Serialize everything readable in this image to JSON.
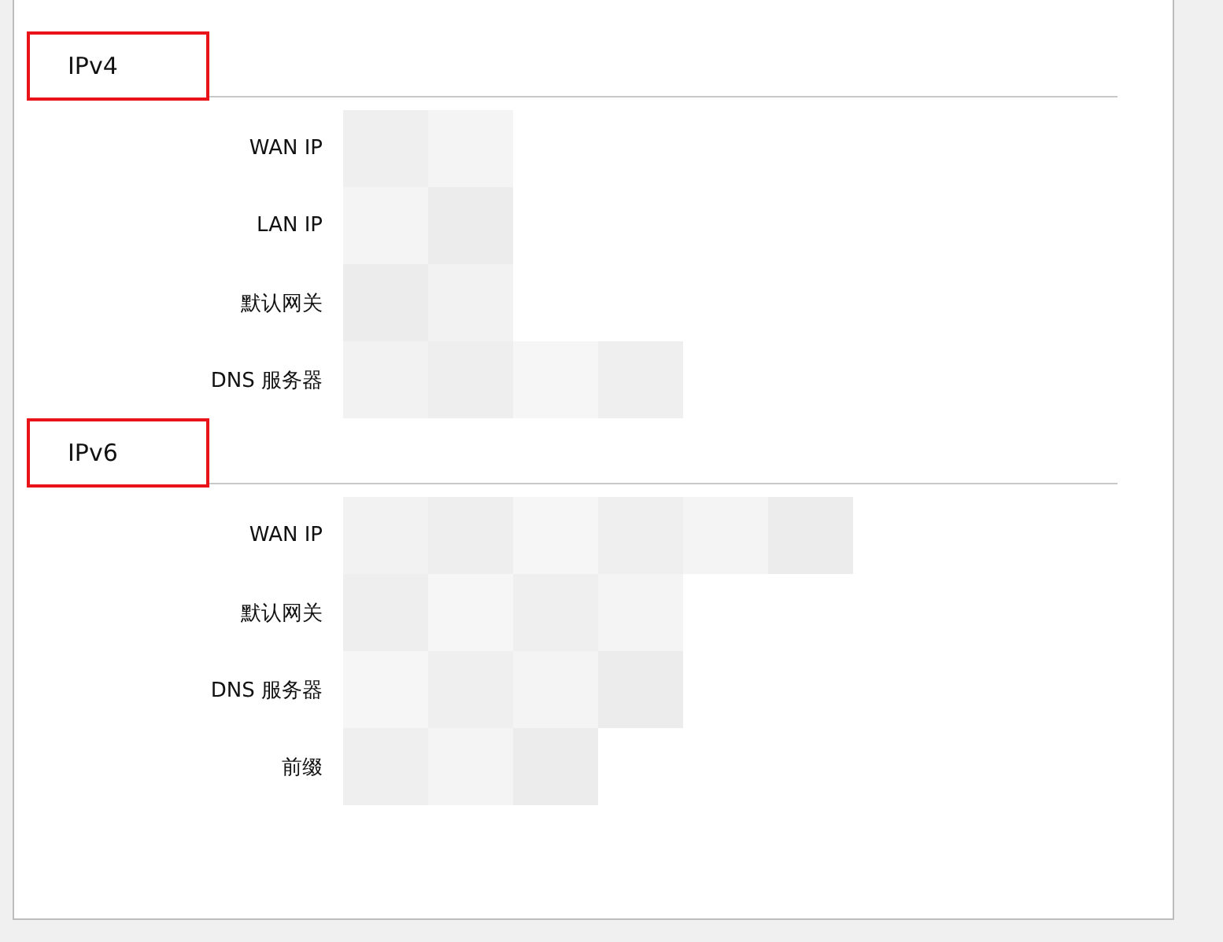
{
  "sections": [
    {
      "title": "IPv4",
      "highlighted": true,
      "rows": [
        {
          "label": "WAN IP"
        },
        {
          "label": "LAN IP"
        },
        {
          "label": "默认网关"
        },
        {
          "label": "DNS 服务器"
        }
      ]
    },
    {
      "title": "IPv6",
      "highlighted": true,
      "rows": [
        {
          "label": "WAN IP"
        },
        {
          "label": "默认网关"
        },
        {
          "label": "DNS 服务器"
        },
        {
          "label": "前缀"
        }
      ]
    }
  ]
}
